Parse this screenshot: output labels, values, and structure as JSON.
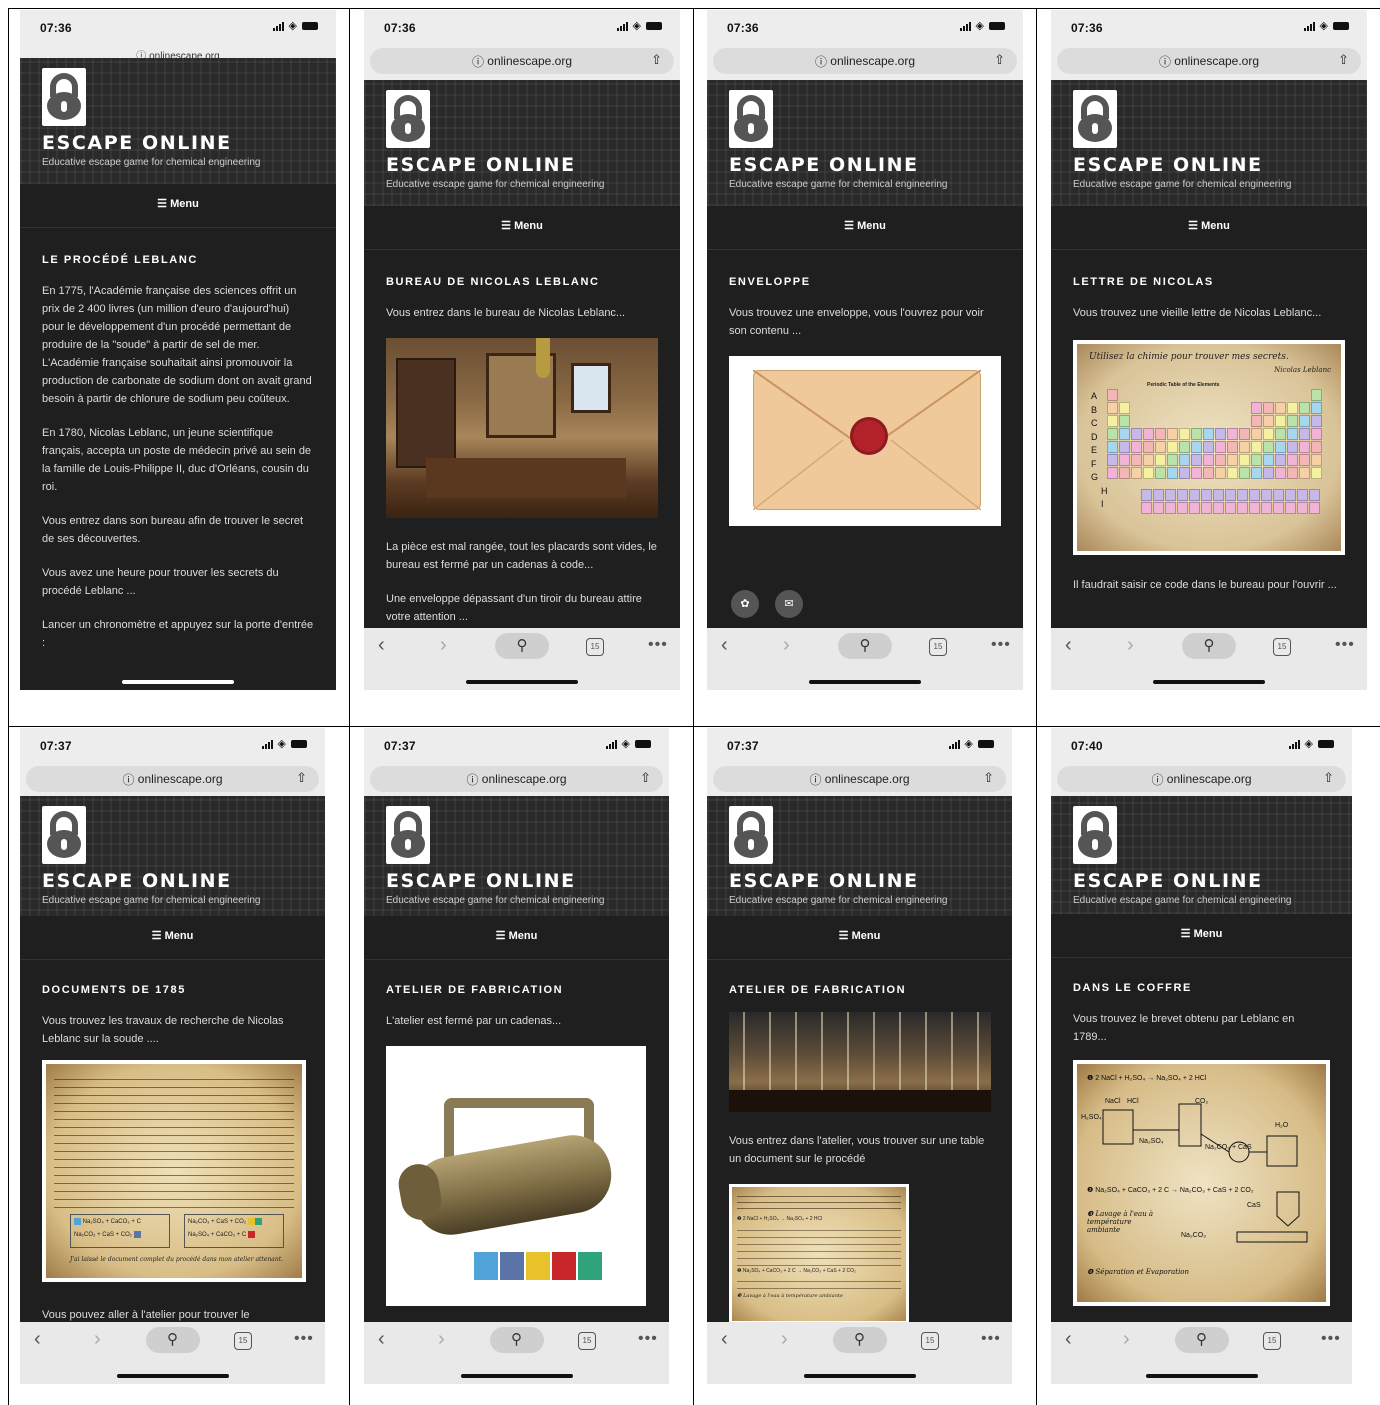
{
  "site": {
    "url": "onlinescape.org",
    "title": "ESCAPE ONLINE",
    "tagline": "Educative escape game for chemical engineering",
    "menu": "Menu"
  },
  "toolbar": {
    "tabs_count": "15"
  },
  "screens": [
    {
      "time": "07:36",
      "page_title": "LE PROCÉDÉ LEBLANC",
      "paragraphs": [
        "En 1775, l'Académie française des sciences offrit un prix de 2 400 livres (un million d'euro d'aujourd'hui) pour le développement d'un procédé permettant de produire de la \"soude\" à partir de sel de mer. L'Académie française souhaitait ainsi promouvoir la production de carbonate de sodium dont on avait grand besoin à partir de chlorure de sodium peu coûteux.",
        "En 1780, Nicolas Leblanc, un jeune scientifique français, accepta un poste de médecin privé au sein de la famille de Louis-Philippe II, duc d'Orléans, cousin du roi.",
        "Vous entrez dans son bureau afin de trouver le secret de ses découvertes.",
        "Vous avez une heure pour trouver les secrets du procédé Leblanc ...",
        "Lancer un chronomètre et appuyez sur la porte d'entrée :"
      ]
    },
    {
      "time": "07:36",
      "page_title": "BUREAU DE NICOLAS LEBLANC",
      "intro": "Vous entrez dans le bureau de Nicolas Leblanc...",
      "after": [
        "La pièce est mal rangée, tout les placards sont vides, le bureau est fermé par un cadenas à code...",
        "Une enveloppe dépassant d'un tiroir du bureau attire votre attention ..."
      ]
    },
    {
      "time": "07:36",
      "page_title": "ENVELOPPE",
      "intro": "Vous trouvez une enveloppe, vous l'ouvrez pour voir son contenu ..."
    },
    {
      "time": "07:36",
      "page_title": "LETTRE DE NICOLAS",
      "intro": "Vous trouvez une vieille lettre de Nicolas Leblanc...",
      "letter_heading": "Utilisez la chimie pour trouver mes secrets.",
      "letter_sign": "Nicolas Leblanc",
      "table_title": "Periodic Table of the Elements",
      "row_letters": [
        "A",
        "B",
        "C",
        "D",
        "E",
        "F",
        "G",
        "H",
        "I"
      ],
      "after": "Il faudrait saisir ce code dans le bureau pour l'ouvrir ..."
    },
    {
      "time": "07:37",
      "page_title": "DOCUMENTS DE 1785",
      "intro": "Vous trouvez les travaux de recherche de Nicolas Leblanc sur la soude ....",
      "eq_left_1": "Na₂SO₄ + CaCO₃ + C",
      "eq_left_2": "Na₂CO₃ + CaS + CO₂",
      "eq_right_1": "Na₂CO₃ + CaS + CO₂",
      "eq_right_2": "Na₂SO₄ + CaCO₃ + C",
      "doc_footer": "J'ai laissé le document complet du procédé dans mon atelier attenant.",
      "after": "Vous pouvez aller à l'atelier pour trouver le"
    },
    {
      "time": "07:37",
      "page_title": "ATELIER DE FABRICATION",
      "intro": "L'atelier est fermé par un cadenas..."
    },
    {
      "time": "07:37",
      "page_title": "ATELIER DE FABRICATION",
      "intro": "Vous entrez dans l'atelier, vous trouver sur une table un document sur le procédé",
      "eq1": "2 NaCl + H₂SO₄ → Na₂SO₄ + 2 HCl",
      "eq2": "Na₂SO₄ + CaCO₃ + 2 C → Na₂CO₃ + CaS + 2 CO₂",
      "step3": "Lavage à l'eau à température ambiante"
    },
    {
      "time": "07:40",
      "page_title": "DANS LE COFFRE",
      "intro": "Vous trouvez le brevet obtenu par Leblanc en 1789...",
      "eq1": "2 NaCl + H₂SO₄ → Na₂SO₄ + 2 HCl",
      "eq2": "Na₂SO₄ + CaCO₃ + 2 C → Na₂CO₃ + CaS + 2 CO₂",
      "labels": [
        "NaCl",
        "HCl",
        "H₂SO₄",
        "CO₂",
        "H₂O",
        "Na₂SO₄",
        "Na₂CO₃ + CaS",
        "CaS",
        "Na₂CO₃"
      ],
      "step3": "Lavage à l'eau à température ambiante",
      "step4": "Séparation et Evaporation"
    }
  ],
  "colors": {
    "lock_blue": "#4fa3d9",
    "lock_slate": "#5a74a8",
    "lock_yellow": "#e8c22a",
    "lock_red": "#c8262b",
    "lock_green": "#2fa37a"
  }
}
